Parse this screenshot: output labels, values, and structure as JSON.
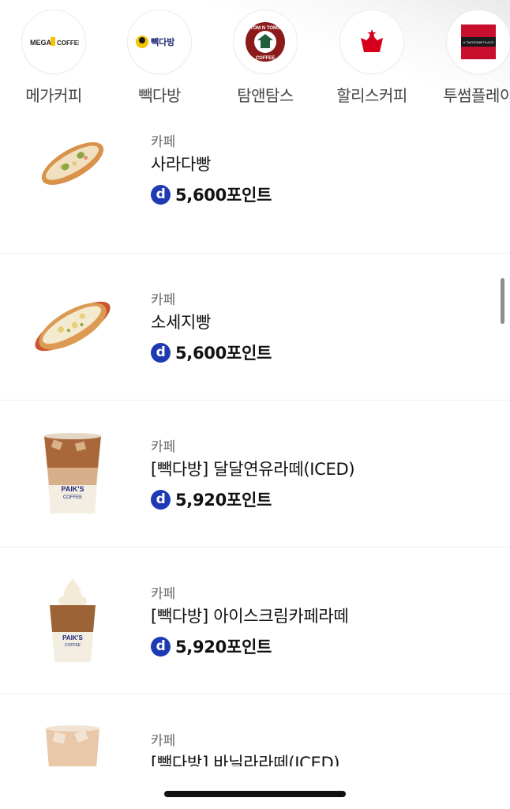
{
  "brands": [
    {
      "name": "메가커피",
      "logo_text": "MEGA COFFEE",
      "color": "#f2c300"
    },
    {
      "name": "빽다방",
      "logo_text": "빽다방",
      "color": "#f5c400"
    },
    {
      "name": "탐앤탐스",
      "logo_text": "TOM N TOMS COFFEE",
      "color": "#8b1a1a"
    },
    {
      "name": "할리스커피",
      "logo_text": "",
      "color": "#d6001c"
    },
    {
      "name": "투썸플레이",
      "logo_text": "A TWOSOME PLACE",
      "color": "#c8102e"
    }
  ],
  "products": [
    {
      "category": "카페",
      "name": "사라다빵",
      "price": "5,600포인트"
    },
    {
      "category": "카페",
      "name": "소세지빵",
      "price": "5,600포인트"
    },
    {
      "category": "카페",
      "name": "[빽다방] 달달연유라떼(ICED)",
      "price": "5,920포인트"
    },
    {
      "category": "카페",
      "name": "[빽다방] 아이스크림카페라떼",
      "price": "5,920포인트"
    },
    {
      "category": "카페",
      "name": "[빽다방] 바닐라라떼(ICED)",
      "price": ""
    }
  ],
  "point_icon": {
    "symbol": "d",
    "color": "#1f3bb3"
  },
  "colors": {
    "accent": "#1f3bb3",
    "divider": "#efefef"
  }
}
